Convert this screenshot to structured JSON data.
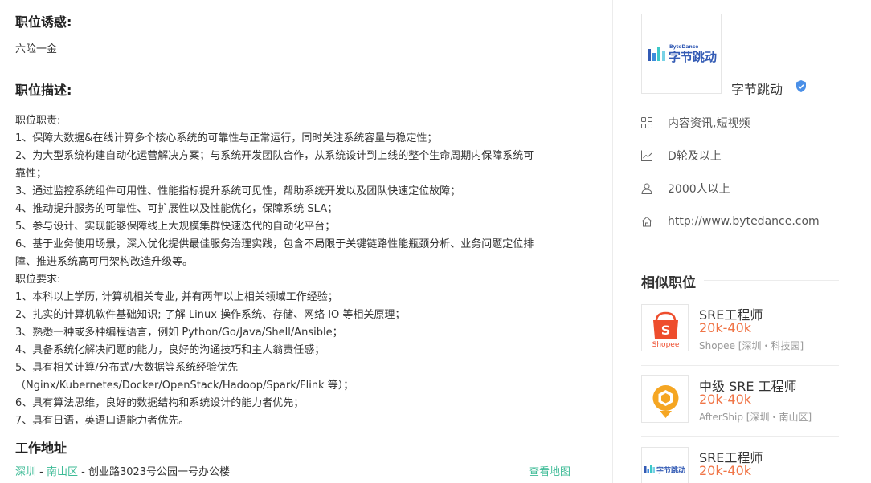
{
  "perks": {
    "heading": "职位诱惑:",
    "text": "六险一金"
  },
  "description": {
    "heading": "职位描述:",
    "lines": [
      "职位职责:",
      "1、保障大数据&在线计算多个核心系统的可靠性与正常运行，同时关注系统容量与稳定性；",
      "2、为大型系统构建自动化运营解决方案；与系统开发团队合作，从系统设计到上线的整个生命周期内保障系统可",
      "靠性；",
      "3、通过监控系统组件可用性、性能指标提升系统可见性，帮助系统开发以及团队快速定位故障；",
      "4、推动提升服务的可靠性、可扩展性以及性能优化，保障系统 SLA；",
      "5、参与设计、实现能够保障线上大规模集群快速迭代的自动化平台；",
      "6、基于业务使用场景，深入优化提供最佳服务治理实践，包含不局限于关键链路性能瓶颈分析、业务问题定位排",
      "障、推进系统高可用架构改造升级等。",
      "职位要求:",
      "1、本科以上学历, 计算机相关专业, 并有两年以上相关领域工作经验；",
      "2、扎实的计算机软件基础知识; 了解 Linux 操作系统、存储、网络 IO 等相关原理；",
      "3、熟悉一种或多种编程语言，例如 Python/Go/Java/Shell/Ansible；",
      "4、具备系统化解决问题的能力，良好的沟通技巧和主人翁责任感；",
      "5、具有相关计算/分布式/大数据等系统经验优先",
      "（Nginx/Kubernetes/Docker/OpenStack/Hadoop/Spark/Flink 等）；",
      "6、具有算法思维，良好的数据结构和系统设计的能力者优先；",
      "7、具有日语，英语口语能力者优先。"
    ]
  },
  "address": {
    "heading": "工作地址",
    "city": "深圳",
    "sep1": " - ",
    "district": "南山区",
    "sep2": " - ",
    "street": "创业路3023号公园一号办公楼",
    "map_link": "查看地图"
  },
  "company": {
    "logo_small": "ByteDance",
    "logo_text": "字节跳动",
    "name": "字节跳动",
    "industry": "内容资讯,短视频",
    "stage": "D轮及以上",
    "size": "2000人以上",
    "website": "http://www.bytedance.com",
    "icons": [
      "grid-icon",
      "chart-icon",
      "person-icon",
      "home-icon"
    ],
    "verify_icon": "shield-check-icon"
  },
  "similar": {
    "heading": "相似职位",
    "jobs": [
      {
        "title": "SRE工程师",
        "salary": "20k-40k",
        "company": "Shopee [深圳・科技园]",
        "logo": "Shopee"
      },
      {
        "title": "中级 SRE 工程师",
        "salary": "20k-40k",
        "company": "AfterShip [深圳・南山区]",
        "logo": ""
      },
      {
        "title": "SRE工程师",
        "salary": "20k-40k",
        "company": "",
        "logo": "字节跳动"
      }
    ]
  },
  "colors": {
    "link": "#3dbb96",
    "salary": "#f07547",
    "bytedance_blue": "#325ab4",
    "shopee_orange": "#ee4d2d",
    "aftership_orange": "#f5a623"
  }
}
